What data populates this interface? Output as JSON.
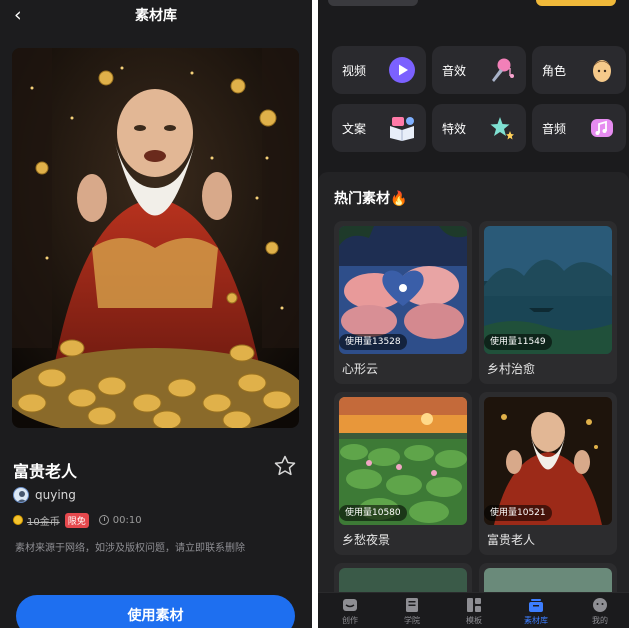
{
  "detail": {
    "header": {
      "back_glyph": "‹",
      "title": "素材库"
    },
    "title": "富贵老人",
    "author": "quying",
    "price": "10金币",
    "badge": "限免",
    "duration": "00:10",
    "notice": "素材来源于网络，如涉及版权问题，请立即联系删除",
    "use_button": "使用素材"
  },
  "library": {
    "categories": [
      {
        "label": "视频",
        "icon": "play-icon"
      },
      {
        "label": "音效",
        "icon": "microphone-icon"
      },
      {
        "label": "角色",
        "icon": "face-icon"
      },
      {
        "label": "文案",
        "icon": "book-icon"
      },
      {
        "label": "特效",
        "icon": "stars-icon"
      },
      {
        "label": "音频",
        "icon": "music-cube-icon"
      }
    ],
    "hot_title": "热门素材🔥",
    "cards": [
      {
        "name": "心形云",
        "usage": "使用量13528"
      },
      {
        "name": "乡村治愈",
        "usage": "使用量11549"
      },
      {
        "name": "乡愁夜景",
        "usage": "使用量10580"
      },
      {
        "name": "富贵老人",
        "usage": "使用量10521"
      }
    ]
  },
  "tabbar": {
    "tabs": [
      {
        "label": "创作",
        "icon": "create-icon"
      },
      {
        "label": "学院",
        "icon": "academy-icon"
      },
      {
        "label": "模板",
        "icon": "template-icon"
      },
      {
        "label": "素材库",
        "icon": "library-icon",
        "active": true
      },
      {
        "label": "我的",
        "icon": "profile-icon"
      }
    ]
  },
  "colors": {
    "accent": "#1e6ff0",
    "active_tab": "#3d7eff",
    "badge": "#e5484d"
  }
}
